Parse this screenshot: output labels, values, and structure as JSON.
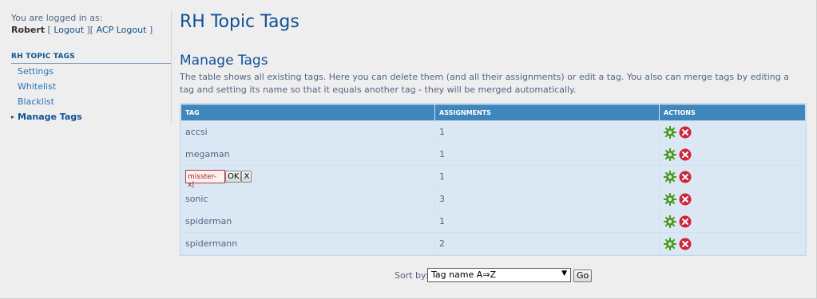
{
  "login": {
    "prefix": "You are logged in as:",
    "username": "Robert",
    "logout_label": "Logout",
    "acp_logout_label": "ACP Logout"
  },
  "sidebar": {
    "heading": "RH TOPIC TAGS",
    "items": [
      {
        "label": "Settings"
      },
      {
        "label": "Whitelist"
      },
      {
        "label": "Blacklist"
      },
      {
        "label": "Manage Tags"
      }
    ]
  },
  "main": {
    "title": "RH Topic Tags",
    "section_title": "Manage Tags",
    "description": "The table shows all existing tags. Here you can delete them (and all their assignments) or edit a tag. You also can merge tags by editing a tag and setting its name so that it equals another tag - they will be merged automatically."
  },
  "table": {
    "headers": [
      "TAG",
      "ASSIGNMENTS",
      "ACTIONS"
    ],
    "rows": [
      {
        "tag": "accsi",
        "assignments": "1"
      },
      {
        "tag": "megaman",
        "assignments": "1"
      },
      {
        "tag": "missterx",
        "assignments": "1",
        "editing": true,
        "edit_value": "misster-x|",
        "ok_label": "OK",
        "cancel_label": "X"
      },
      {
        "tag": "sonic",
        "assignments": "3"
      },
      {
        "tag": "spiderman",
        "assignments": "1"
      },
      {
        "tag": "spidermann",
        "assignments": "2"
      }
    ]
  },
  "sort": {
    "label": "Sort by:",
    "selected": "Tag name A⇒Z",
    "go_label": "Go"
  },
  "colors": {
    "accent": "#115098",
    "header_bg": "#3e86bb",
    "row_bg": "#dbe8f4",
    "edit_icon": "#4c9a1e",
    "delete_icon": "#d0243c"
  }
}
